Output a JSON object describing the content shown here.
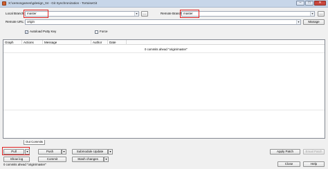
{
  "window": {
    "title": "X:\\cemongames\\gdesign_04 - Git Synchronization - TortoiseGit"
  },
  "form": {
    "local_branch_label": "Local Branch:",
    "local_branch_value": "master",
    "browse_local_label": "...",
    "remote_branch_label": "Remote Branch:",
    "remote_branch_value": "master",
    "browse_remote_label": "...",
    "remote_url_label": "Remote URL:",
    "remote_url_value": "origin",
    "manage_label": "Manage",
    "autoload_putty_label": "Autoload Putty Key",
    "autoload_putty_checked": true,
    "force_label": "Force",
    "force_checked": false
  },
  "grid": {
    "columns": [
      "Graph",
      "Actions",
      "Message",
      "Author",
      "Date"
    ],
    "message": "0 commits ahead \"origin/master\""
  },
  "tabs": [
    {
      "label": "Out Commits",
      "active": true
    }
  ],
  "actions": {
    "pull_label": "Pull",
    "push_label": "Push",
    "submodule_update_label": "Submodule Update",
    "show_log_label": "Show log",
    "commit_label": "Commit",
    "stash_changes_label": "Stash changes",
    "apply_patch_label": "Apply Patch",
    "email_patch_label": "Email Patch",
    "close_label": "Close",
    "help_label": "Help"
  },
  "status": {
    "text": "0 commits ahead \"origin/master\""
  },
  "colors": {
    "highlight": "#e02020",
    "titlebar": "#c7d6e9"
  }
}
